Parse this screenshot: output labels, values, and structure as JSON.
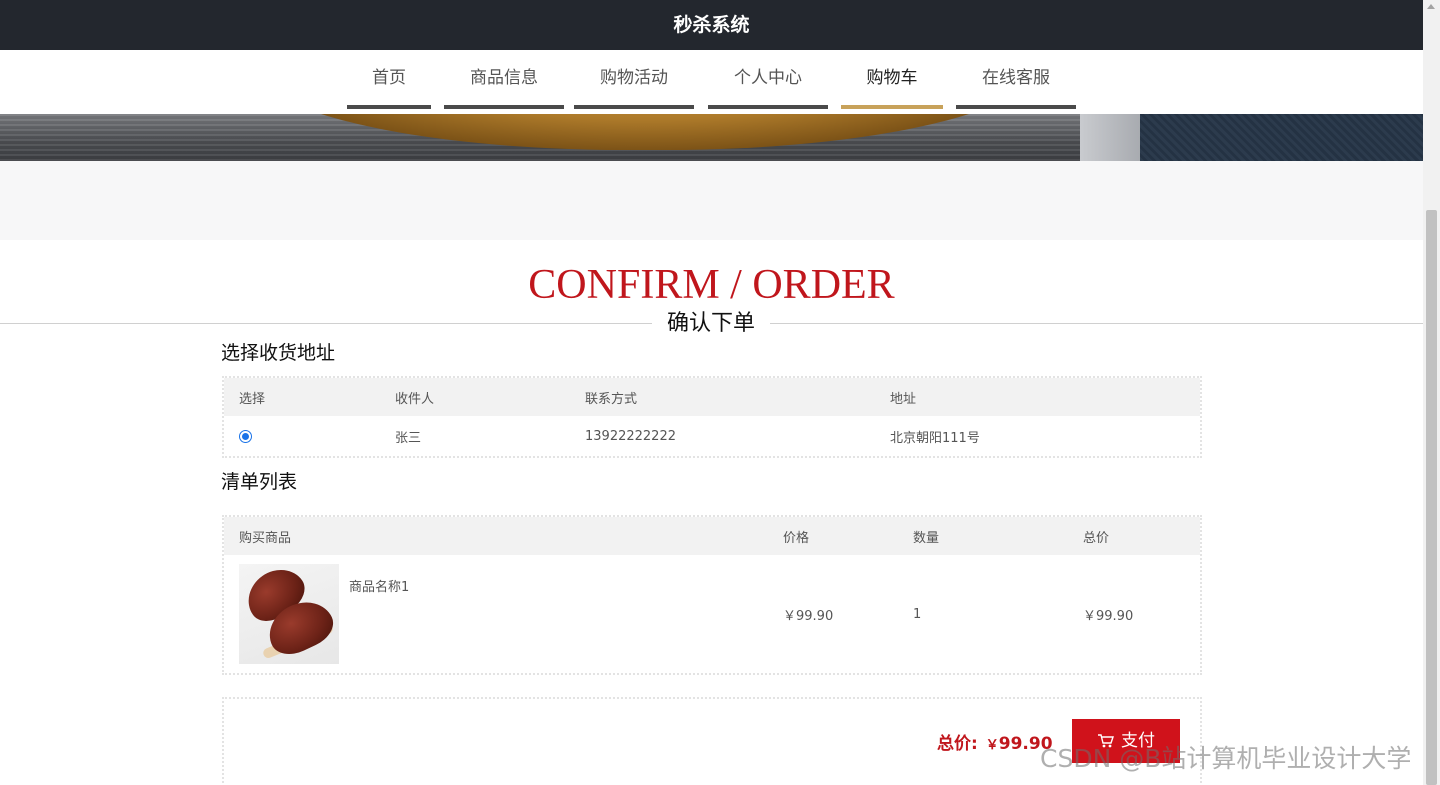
{
  "header": {
    "title": "秒杀系统"
  },
  "nav": {
    "items": [
      {
        "label": "首页"
      },
      {
        "label": "商品信息"
      },
      {
        "label": "购物活动"
      },
      {
        "label": "个人中心"
      },
      {
        "label": "购物车",
        "active": true
      },
      {
        "label": "在线客服"
      }
    ]
  },
  "page": {
    "title_en": "CONFIRM / ORDER",
    "title_cn": "确认下单"
  },
  "address": {
    "heading": "选择收货地址",
    "columns": [
      "选择",
      "收件人",
      "联系方式",
      "地址"
    ],
    "rows": [
      {
        "selected": true,
        "recipient": "张三",
        "phone": "13922222222",
        "address": "北京朝阳111号"
      }
    ]
  },
  "order": {
    "heading": "清单列表",
    "columns": [
      "购买商品",
      "价格",
      "数量",
      "总价"
    ],
    "rows": [
      {
        "name": "商品名称1",
        "price": "￥99.90",
        "quantity": "1",
        "total": "￥99.90",
        "image_icon": "brown-leather-shoes-image"
      }
    ]
  },
  "summary": {
    "total_label": "总价:",
    "currency": "￥",
    "total_value": "99.90",
    "pay_label": "支付",
    "pay_icon": "cart-icon"
  },
  "watermark": "CSDN @B站计算机毕业设计大学",
  "colors": {
    "header_bg": "#23272e",
    "accent_red": "#c0161c",
    "nav_active": "#c8a25a",
    "nav_underline": "#4a4a4a",
    "pay_button": "#d0121b"
  }
}
